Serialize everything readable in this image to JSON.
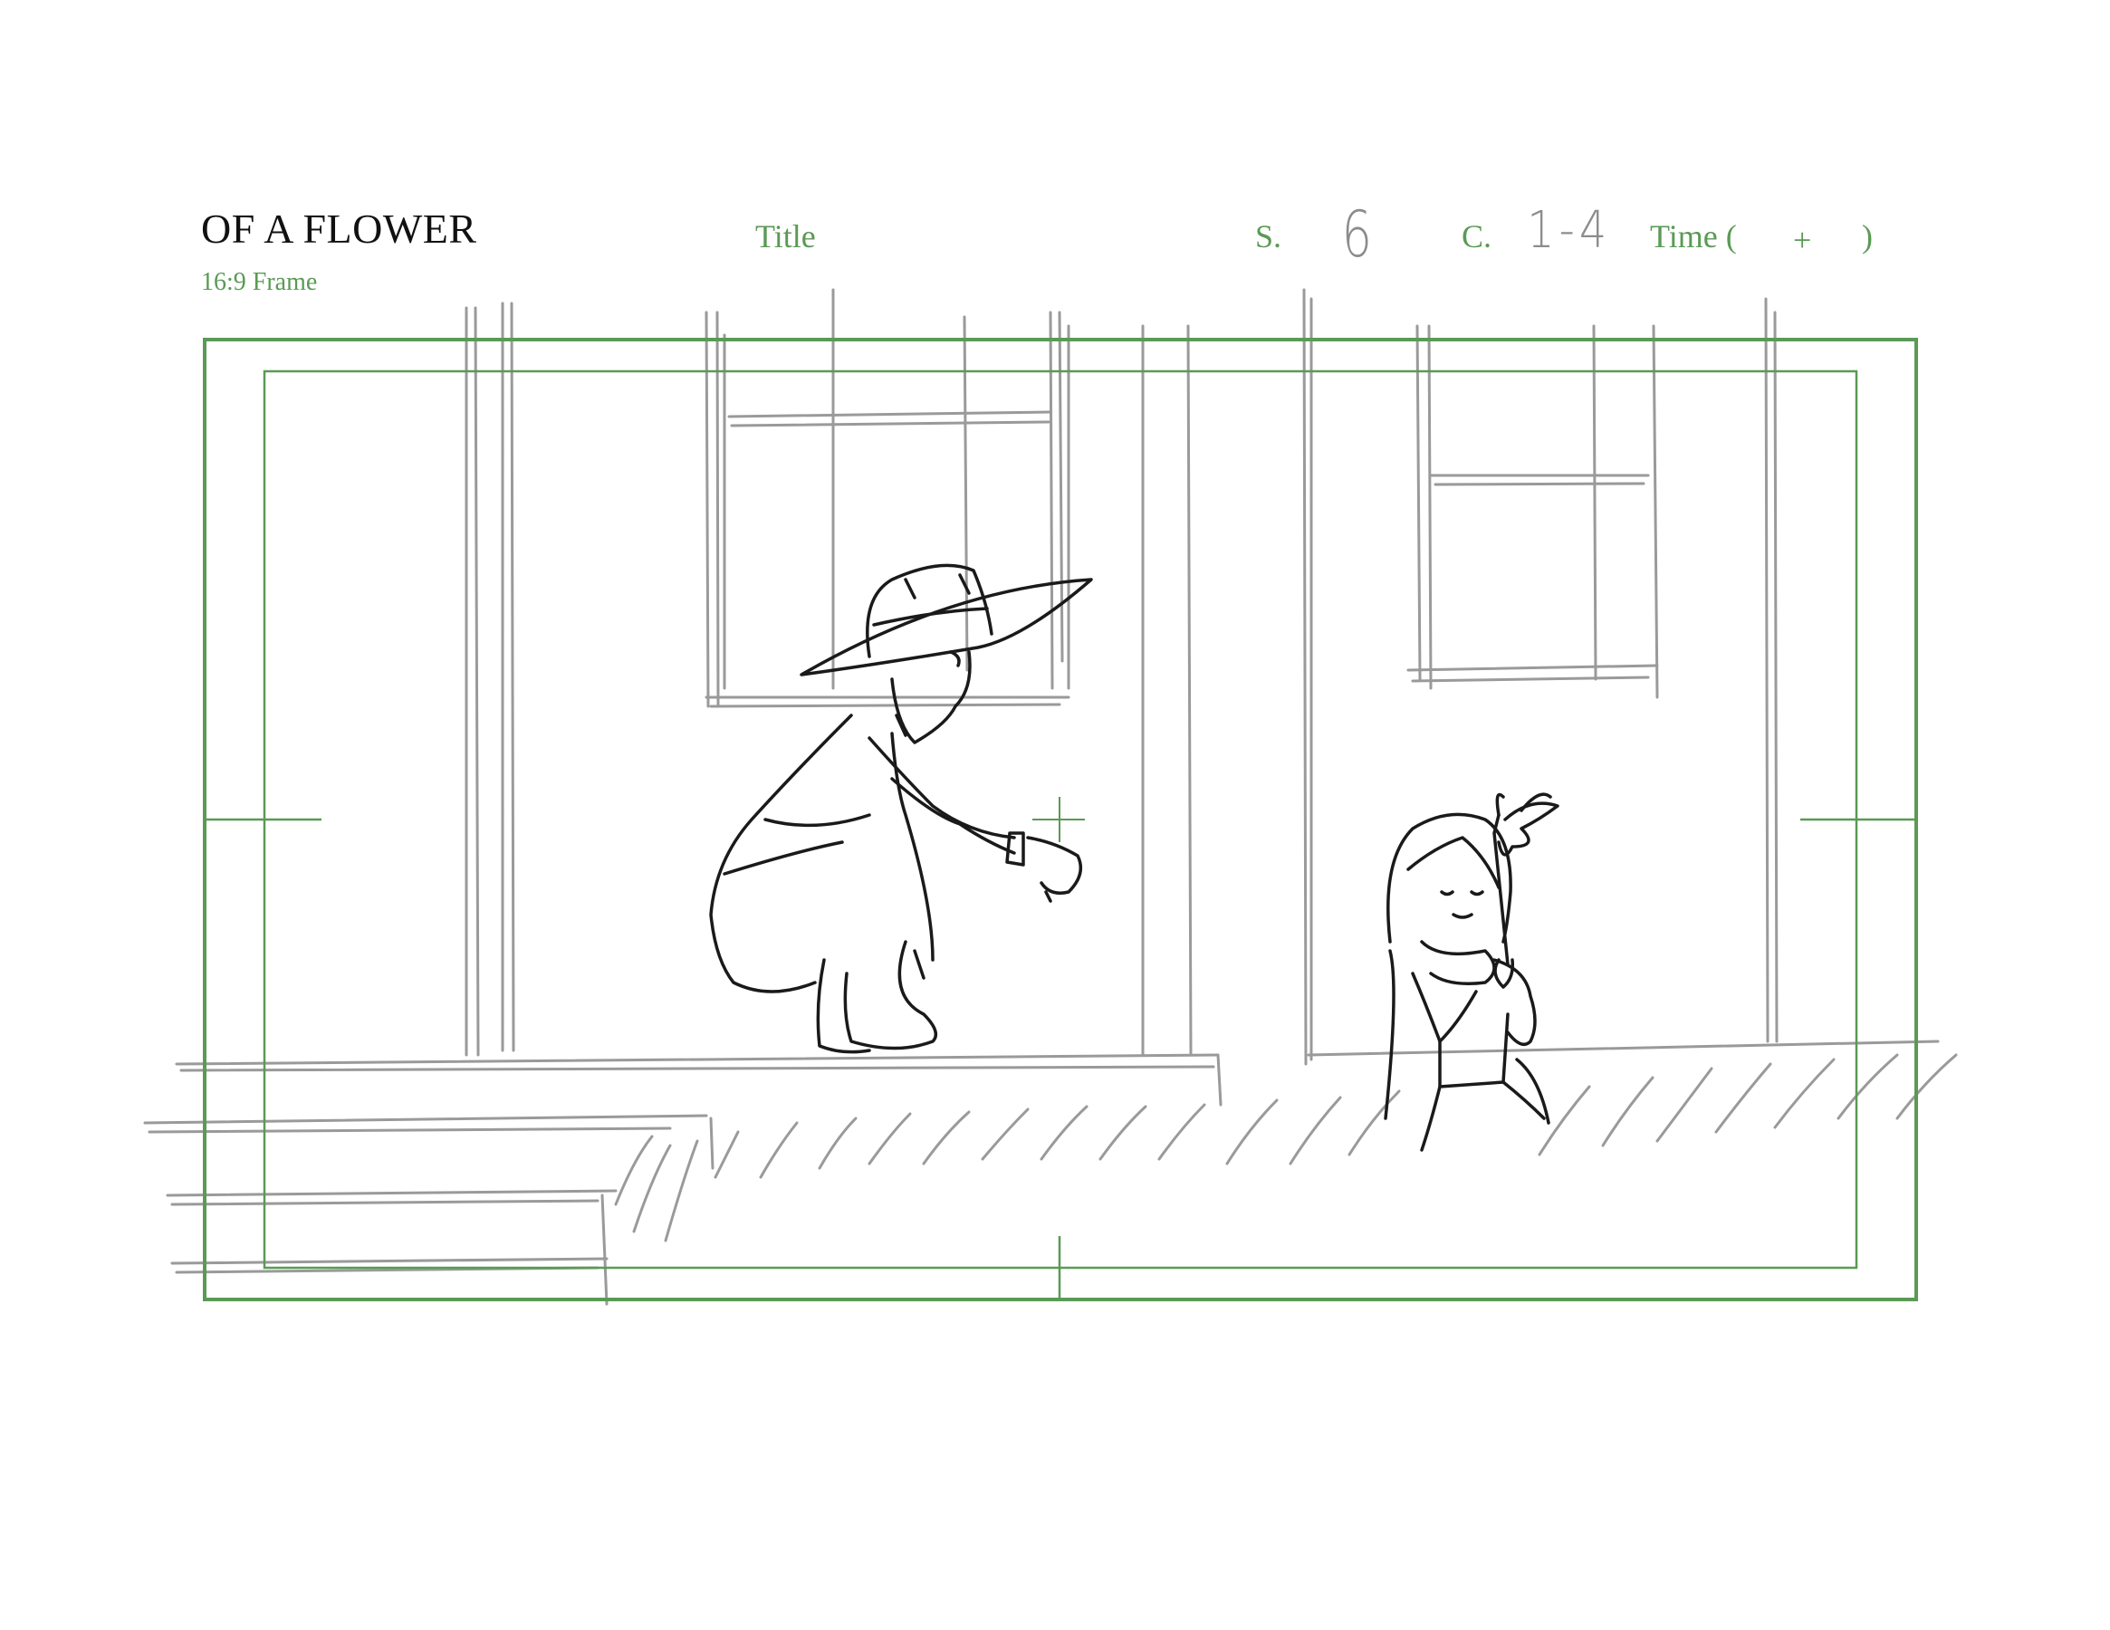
{
  "header": {
    "project_title": "OF A FLOWER",
    "frame_label": "16:9 Frame",
    "title_label": "Title",
    "scene_label": "S.",
    "scene_value": "6",
    "cut_label": "C.",
    "cut_value": "1-4",
    "time_label": "Time (",
    "time_plus": "+",
    "time_close": ")"
  },
  "colors": {
    "frame_green": "#5a9a55",
    "sketch_gray": "#9a9a9a",
    "ink": "#1a1a1a"
  }
}
